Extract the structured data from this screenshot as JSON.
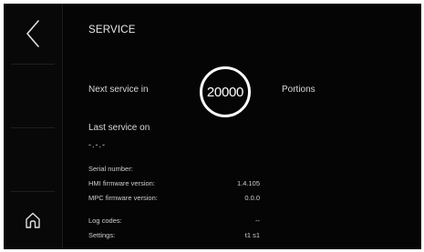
{
  "header": {
    "title": "SERVICE"
  },
  "service": {
    "next_label": "Next service in",
    "next_value": "20000",
    "next_unit": "Portions",
    "last_label": "Last service on",
    "last_value": "-.-.-"
  },
  "info": {
    "serial_label": "Serial number:",
    "serial_value": "",
    "hmi_label": "HMI firmware version:",
    "hmi_value": "1.4.105",
    "mpc_label": "MPC firmware version:",
    "mpc_value": "0.0.0",
    "log_label": "Log codes:",
    "log_value": "--",
    "settings_label": "Settings:",
    "settings_value": "t1 s1"
  },
  "icons": {
    "back": "chevron-left-icon",
    "home": "home-icon"
  }
}
